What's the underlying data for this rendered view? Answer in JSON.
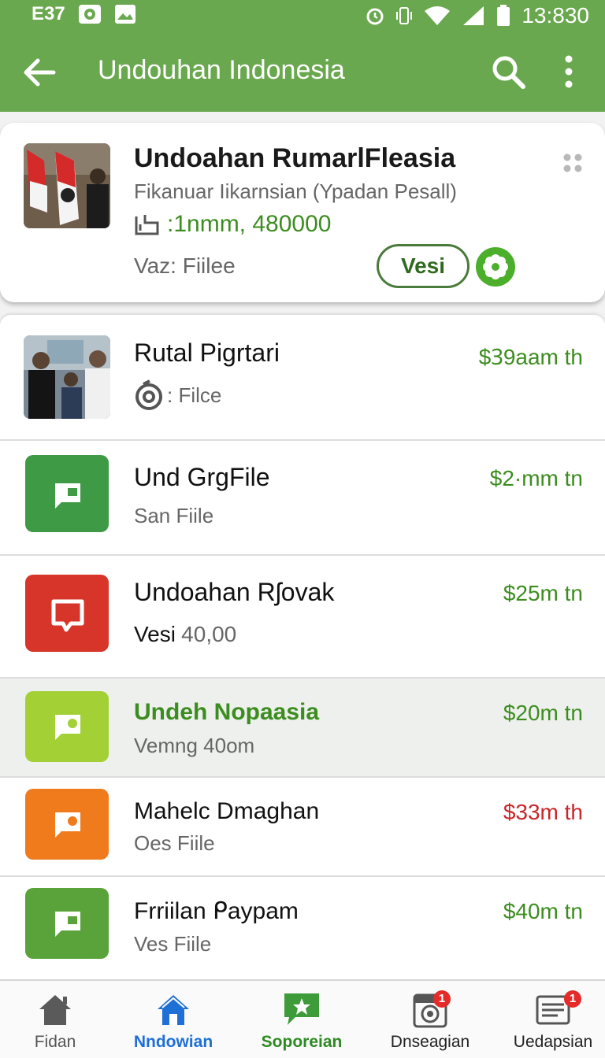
{
  "status_bar": {
    "left_text": "E37",
    "time": "13:830"
  },
  "app_bar": {
    "title": "Undouhan Indonesia",
    "back_icon": "arrow-left-icon",
    "search_icon": "search-icon",
    "more_icon": "more-vert-icon"
  },
  "featured": {
    "title": "Undoahan RumarlFleasia",
    "subtitle": "Fikanuar Iikarnsian (Ypadan Pesall)",
    "stat_text": ":1nmm, 480000",
    "meta": "Vaz: Fiilee",
    "pill_label": "Vesi",
    "colors": {
      "accent": "#3c8d1f",
      "pill_border": "#4a7b3a"
    }
  },
  "list": [
    {
      "title": "Rutal Pigrtari",
      "subtitle": ": Filce",
      "price": "$Ꝫ9aam th",
      "icon": "photo",
      "subtitle_icon": "clock-swirl-icon",
      "price_color": "#3c8d1f"
    },
    {
      "title": "Und GrgFile",
      "subtitle": "San Fiile",
      "price": "$2·mm tn",
      "icon": "message-icon",
      "icon_color": "#3f9a46",
      "price_color": "#3c8d1f"
    },
    {
      "title": "Undoahan Rʃovak",
      "subtitle_strong": "Vesi",
      "subtitle": "40,00",
      "price": "$25m tn",
      "icon": "message-icon",
      "icon_color": "#d8352a",
      "price_color": "#3c8d1f"
    },
    {
      "title": "Undeh Nopaasia",
      "subtitle": "Vemng 40om",
      "price": "$20m tn",
      "icon": "message-icon",
      "icon_color": "#a3d135",
      "price_color": "#3c8d1f",
      "title_color": "#3c8d1f",
      "highlighted": true
    },
    {
      "title": "Mahelc Dmaghan",
      "subtitle": "Oes Fiile",
      "price": "$33m th",
      "icon": "message-icon",
      "icon_color": "#ef7b1c",
      "price_color": "#c9262a"
    },
    {
      "title": "Frriilan ᑭaypam",
      "subtitle": "Ves Fiile",
      "price": "$40m tn",
      "icon": "message-icon",
      "icon_color": "#5aa33a",
      "price_color": "#3c8d1f"
    }
  ],
  "bottom_nav": [
    {
      "label": "Fidan",
      "icon": "home-icon"
    },
    {
      "label": "Nndowian",
      "icon": "home-icon",
      "active": true
    },
    {
      "label": "Soporeian",
      "icon": "star-message-icon"
    },
    {
      "label": "Dnseagian",
      "icon": "washer-icon",
      "badge": "1"
    },
    {
      "label": "Uedapsian",
      "icon": "news-icon",
      "badge": "1"
    }
  ]
}
